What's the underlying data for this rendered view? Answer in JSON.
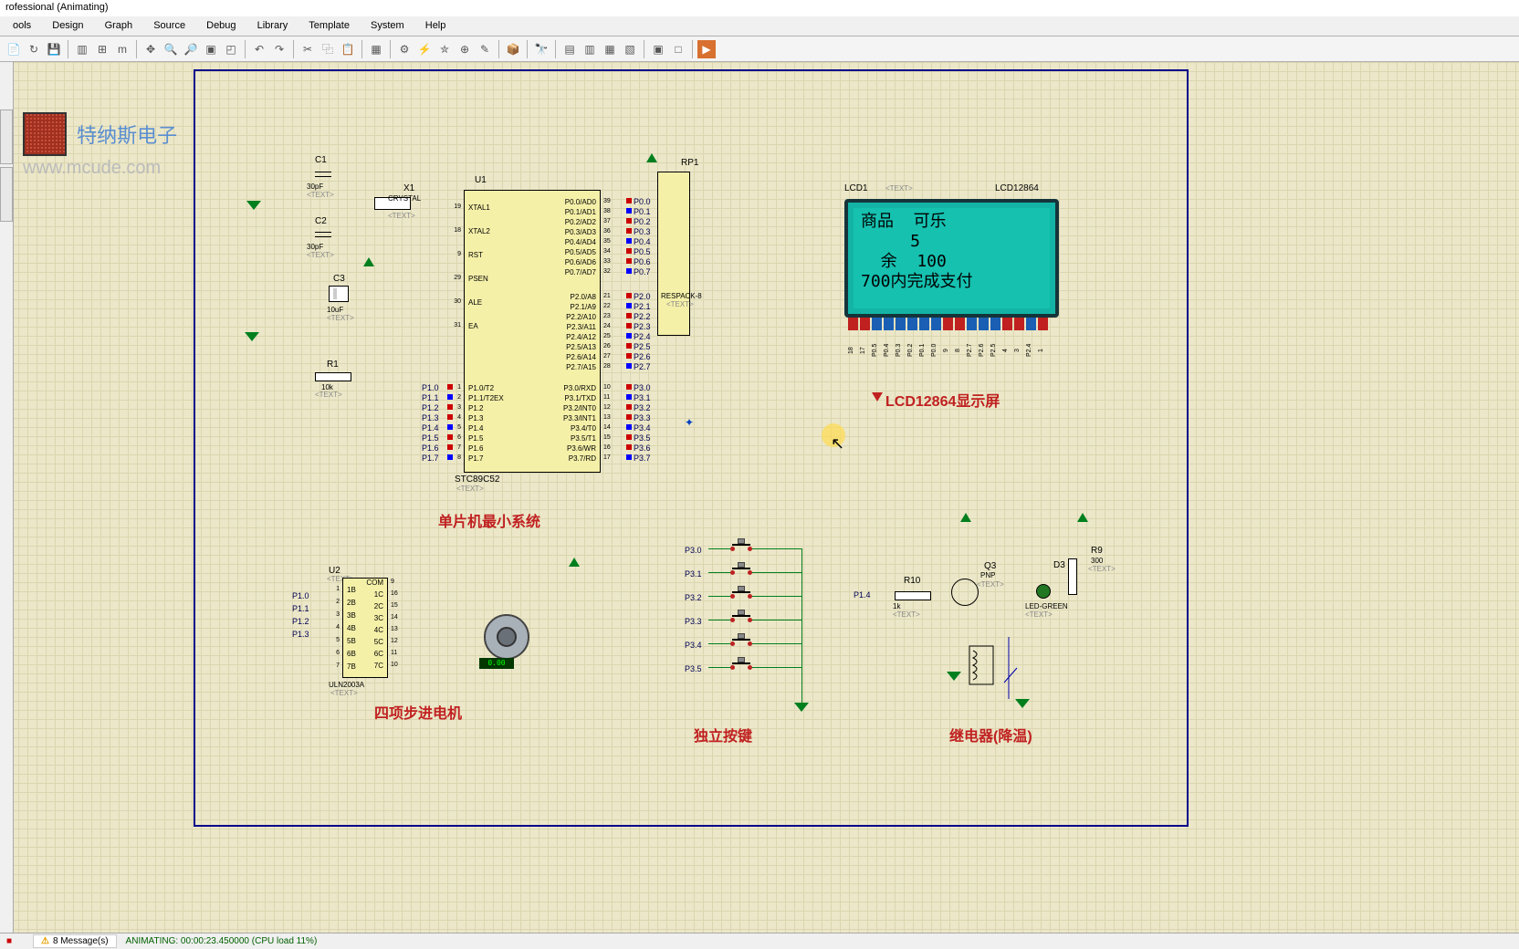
{
  "window": {
    "title": "rofessional (Animating)"
  },
  "menu": {
    "items": [
      "ools",
      "Design",
      "Graph",
      "Source",
      "Debug",
      "Library",
      "Template",
      "System",
      "Help"
    ]
  },
  "toolbar": {
    "icons": [
      "new",
      "open",
      "save",
      "sep",
      "sheet",
      "grid-on",
      "grid-dot",
      "sep",
      "add",
      "zoom-in",
      "zoom-out",
      "zoom-fit",
      "zoom-area",
      "sep",
      "undo",
      "redo",
      "sep",
      "cut",
      "copy",
      "paste",
      "sep",
      "block",
      "sep",
      "tool-a",
      "tool-b",
      "tool-c",
      "tool-d",
      "tool-e",
      "sep",
      "align-l",
      "align-r",
      "sep",
      "to-top",
      "to-bot",
      "sep",
      "page",
      "page2",
      "sep",
      "flag",
      "sep",
      "minus",
      "sep",
      "run"
    ]
  },
  "watermark": {
    "brand": "特纳斯电子",
    "url": "www.mcude.com"
  },
  "mcu": {
    "ref": "U1",
    "part": "STC89C52",
    "textph": "<TEXT>",
    "pins_left_upper": [
      {
        "no": "19",
        "name": "XTAL1"
      },
      {
        "no": "18",
        "name": "XTAL2"
      },
      {
        "no": "9",
        "name": "RST"
      },
      {
        "no": "29",
        "name": "PSEN"
      },
      {
        "no": "30",
        "name": "ALE"
      },
      {
        "no": "31",
        "name": "EA"
      }
    ],
    "pins_left_p1": [
      {
        "no": "1",
        "name": "P1.0/T2"
      },
      {
        "no": "2",
        "name": "P1.1/T2EX"
      },
      {
        "no": "3",
        "name": "P1.2"
      },
      {
        "no": "4",
        "name": "P1.3"
      },
      {
        "no": "5",
        "name": "P1.4"
      },
      {
        "no": "6",
        "name": "P1.5"
      },
      {
        "no": "7",
        "name": "P1.6"
      },
      {
        "no": "8",
        "name": "P1.7"
      }
    ],
    "pins_right_p0": [
      {
        "no": "39",
        "name": "P0.0/AD0"
      },
      {
        "no": "38",
        "name": "P0.1/AD1"
      },
      {
        "no": "37",
        "name": "P0.2/AD2"
      },
      {
        "no": "36",
        "name": "P0.3/AD3"
      },
      {
        "no": "35",
        "name": "P0.4/AD4"
      },
      {
        "no": "34",
        "name": "P0.5/AD5"
      },
      {
        "no": "33",
        "name": "P0.6/AD6"
      },
      {
        "no": "32",
        "name": "P0.7/AD7"
      }
    ],
    "pins_right_p2": [
      {
        "no": "21",
        "name": "P2.0/A8"
      },
      {
        "no": "22",
        "name": "P2.1/A9"
      },
      {
        "no": "23",
        "name": "P2.2/A10"
      },
      {
        "no": "24",
        "name": "P2.3/A11"
      },
      {
        "no": "25",
        "name": "P2.4/A12"
      },
      {
        "no": "26",
        "name": "P2.5/A13"
      },
      {
        "no": "27",
        "name": "P2.6/A14"
      },
      {
        "no": "28",
        "name": "P2.7/A15"
      }
    ],
    "pins_right_p3": [
      {
        "no": "10",
        "name": "P3.0/RXD"
      },
      {
        "no": "11",
        "name": "P3.1/TXD"
      },
      {
        "no": "12",
        "name": "P3.2/INT0"
      },
      {
        "no": "13",
        "name": "P3.3/INT1"
      },
      {
        "no": "14",
        "name": "P3.4/T0"
      },
      {
        "no": "15",
        "name": "P3.5/T1"
      },
      {
        "no": "16",
        "name": "P3.6/WR"
      },
      {
        "no": "17",
        "name": "P3.7/RD"
      }
    ],
    "nets_p1": [
      "P1.0",
      "P1.1",
      "P1.2",
      "P1.3",
      "P1.4",
      "P1.5",
      "P1.6",
      "P1.7"
    ],
    "nets_p0": [
      "P0.0",
      "P0.1",
      "P0.2",
      "P0.3",
      "P0.4",
      "P0.5",
      "P0.6",
      "P0.7"
    ],
    "nets_p2": [
      "P2.0",
      "P2.1",
      "P2.2",
      "P2.3",
      "P2.4",
      "P2.5",
      "P2.6",
      "P2.7"
    ],
    "nets_p3": [
      "P3.0",
      "P3.1",
      "P3.2",
      "P3.3",
      "P3.4",
      "P3.5",
      "P3.6",
      "P3.7"
    ]
  },
  "osc": {
    "c1": {
      "ref": "C1",
      "val": "30pF",
      "textph": "<TEXT>"
    },
    "c2": {
      "ref": "C2",
      "val": "30pF",
      "textph": "<TEXT>"
    },
    "x1": {
      "ref": "X1",
      "val": "CRYSTAL",
      "textph": "<TEXT>"
    },
    "c3": {
      "ref": "C3",
      "val": "10uF",
      "textph": "<TEXT>"
    },
    "r1": {
      "ref": "R1",
      "val": "10k",
      "textph": "<TEXT>"
    }
  },
  "resnet": {
    "ref": "RP1",
    "val": "RESPACK-8",
    "textph": "<TEXT>"
  },
  "lcd": {
    "ref": "LCD1",
    "part": "LCD12864",
    "textph": "<TEXT>",
    "line1": "商品  可乐",
    "line2": "     5",
    "line3": "  余  100",
    "line4": "700内完成支付",
    "pins": [
      "18",
      "17",
      "P0.5",
      "P0.4",
      "P0.3",
      "P0.2",
      "P0.1",
      "P0.0",
      "9",
      "8",
      "P2.7",
      "P2.6",
      "P2.5",
      "4",
      "3",
      "P2.4",
      "1"
    ],
    "title": "LCD12864显示屏"
  },
  "uln": {
    "ref": "U2",
    "part": "ULN2003A",
    "textph": "<TEXT>",
    "left": [
      {
        "no": "1",
        "name": "1B"
      },
      {
        "no": "2",
        "name": "2B"
      },
      {
        "no": "3",
        "name": "3B"
      },
      {
        "no": "4",
        "name": "4B"
      },
      {
        "no": "5",
        "name": "5B"
      },
      {
        "no": "6",
        "name": "6B"
      },
      {
        "no": "7",
        "name": "7B"
      }
    ],
    "leftnets": [
      "P1.0",
      "P1.1",
      "P1.2",
      "P1.3"
    ],
    "right": [
      {
        "no": "9",
        "name": "COM"
      },
      {
        "no": "16",
        "name": "1C"
      },
      {
        "no": "15",
        "name": "2C"
      },
      {
        "no": "14",
        "name": "3C"
      },
      {
        "no": "13",
        "name": "4C"
      },
      {
        "no": "12",
        "name": "5C"
      },
      {
        "no": "11",
        "name": "6C"
      },
      {
        "no": "10",
        "name": "7C"
      }
    ]
  },
  "motor": {
    "disp": "0.00"
  },
  "buttons": {
    "nets": [
      "P3.0",
      "P3.1",
      "P3.2",
      "P3.3",
      "P3.4",
      "P3.5"
    ]
  },
  "relay": {
    "r10": {
      "ref": "R10",
      "val": "1k",
      "textph": "<TEXT>"
    },
    "q3": {
      "ref": "Q3",
      "val": "PNP",
      "textph": "<TEXT>"
    },
    "r9": {
      "ref": "R9",
      "val": "300",
      "textph": "<TEXT>"
    },
    "d3": {
      "ref": "D3",
      "val": "LED-GREEN",
      "textph": "<TEXT>"
    },
    "net": "P1.4"
  },
  "blocks": {
    "mcu": "单片机最小系统",
    "stepper": "四项步进电机",
    "keys": "独立按键",
    "relay": "继电器(降温)"
  },
  "status": {
    "messages": "8 Message(s)",
    "sim": "ANIMATING: 00:00:23.450000 (CPU load 11%)"
  }
}
